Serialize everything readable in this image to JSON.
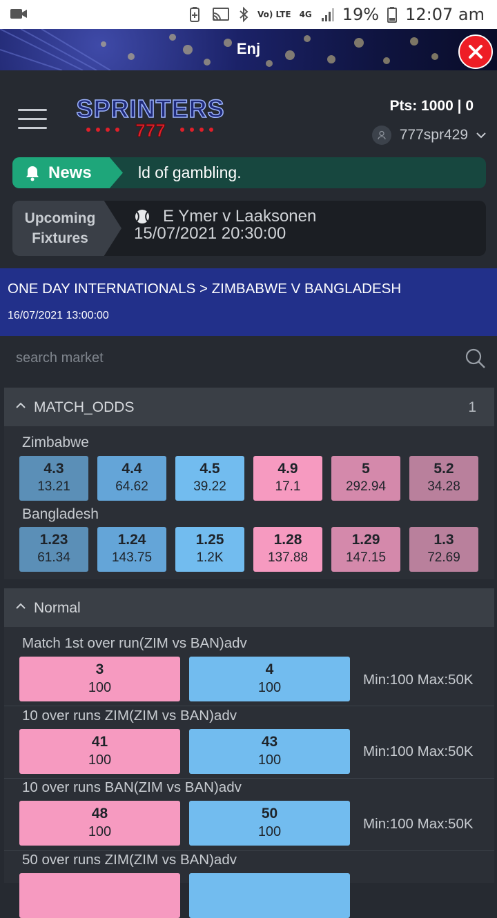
{
  "status_bar": {
    "left_icon": "video-camera-icon",
    "icons": [
      "battery-saver-icon",
      "cast-icon",
      "bluetooth-icon",
      "signal-icon"
    ],
    "volte": "Vo) LTE",
    "network": "4G",
    "battery": "19%",
    "time": "12:07 am"
  },
  "ad_banner": {
    "text": "Enj",
    "close_icon": "close-icon"
  },
  "header": {
    "logo_text": "SPRINTERS",
    "logo_sub": "777",
    "points": "Pts: 1000 | 0",
    "username": "777spr429"
  },
  "news": {
    "label": "News",
    "text": "ld of gambling."
  },
  "upcoming": {
    "label_line1": "Upcoming",
    "label_line2": "Fixtures",
    "event": "E Ymer v Laaksonen",
    "datetime": "15/07/2021 20:30:00"
  },
  "event_header": {
    "breadcrumb": "ONE DAY INTERNATIONALS > ZIMBABWE V BANGLADESH",
    "datetime": "16/07/2021 13:00:00"
  },
  "search": {
    "placeholder": "search market"
  },
  "match_odds": {
    "title": "MATCH_ODDS",
    "count": "1",
    "runners": [
      {
        "name": "Zimbabwe",
        "odds": [
          {
            "price": "4.3",
            "size": "13.21"
          },
          {
            "price": "4.4",
            "size": "64.62"
          },
          {
            "price": "4.5",
            "size": "39.22"
          },
          {
            "price": "4.9",
            "size": "17.1"
          },
          {
            "price": "5",
            "size": "292.94"
          },
          {
            "price": "5.2",
            "size": "34.28"
          }
        ]
      },
      {
        "name": "Bangladesh",
        "odds": [
          {
            "price": "1.23",
            "size": "61.34"
          },
          {
            "price": "1.24",
            "size": "143.75"
          },
          {
            "price": "1.25",
            "size": "1.2K"
          },
          {
            "price": "1.28",
            "size": "137.88"
          },
          {
            "price": "1.29",
            "size": "147.15"
          },
          {
            "price": "1.3",
            "size": "72.69"
          }
        ]
      }
    ]
  },
  "normal": {
    "title": "Normal",
    "markets": [
      {
        "name": "Match 1st over run(ZIM vs BAN)adv",
        "no": {
          "runs": "3",
          "rate": "100"
        },
        "yes": {
          "runs": "4",
          "rate": "100"
        },
        "limits": "Min:100 Max:50K"
      },
      {
        "name": "10 over runs ZIM(ZIM vs BAN)adv",
        "no": {
          "runs": "41",
          "rate": "100"
        },
        "yes": {
          "runs": "43",
          "rate": "100"
        },
        "limits": "Min:100 Max:50K"
      },
      {
        "name": "10 over runs BAN(ZIM vs BAN)adv",
        "no": {
          "runs": "48",
          "rate": "100"
        },
        "yes": {
          "runs": "50",
          "rate": "100"
        },
        "limits": "Min:100 Max:50K"
      },
      {
        "name": "50 over runs ZIM(ZIM vs BAN)adv"
      }
    ]
  }
}
